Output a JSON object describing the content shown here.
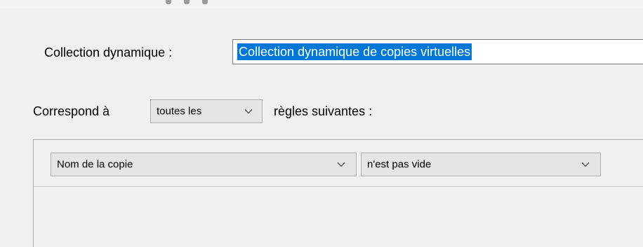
{
  "form": {
    "name_label": "Collection dynamique :",
    "name_value": "Collection dynamique de copies virtuelles",
    "match_label": "Correspond à",
    "match_value": "toutes les",
    "rules_suffix_label": "règles suivantes :"
  },
  "rules": [
    {
      "field": "Nom de la copie",
      "operator": "n'est pas vide"
    }
  ],
  "icons": {
    "dropdown": "chevron-down-icon"
  },
  "colors": {
    "selection_highlight": "#0078d7",
    "window_background": "#f0f0f0",
    "control_background": "#e5e5e5",
    "input_background": "#ffffff"
  }
}
